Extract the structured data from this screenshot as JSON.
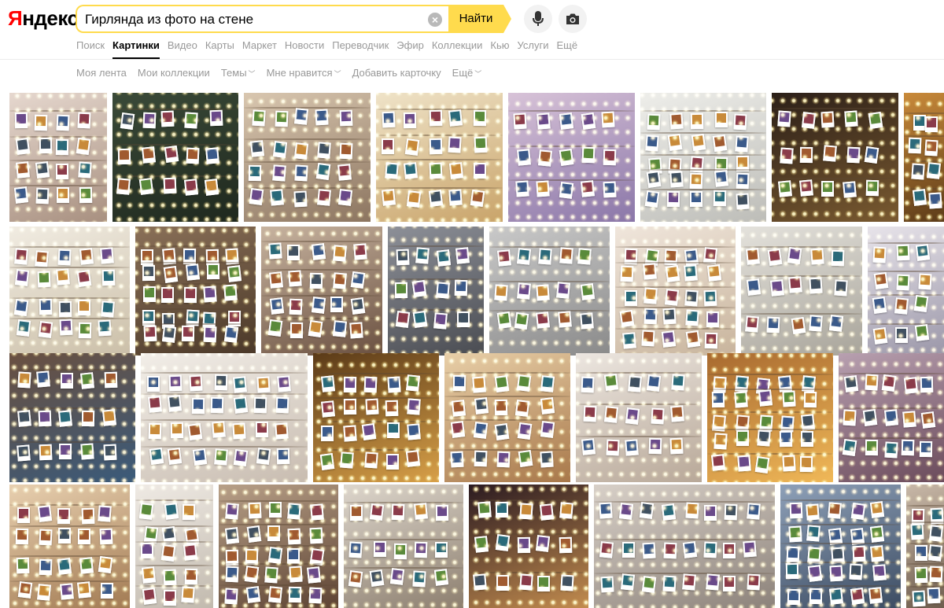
{
  "header": {
    "logo_first": "Я",
    "logo_rest": "ндекс",
    "search_value": "Гирлянда из фото на стене",
    "search_button": "Найти"
  },
  "tabs": [
    {
      "label": "Поиск",
      "active": false
    },
    {
      "label": "Картинки",
      "active": true
    },
    {
      "label": "Видео",
      "active": false
    },
    {
      "label": "Карты",
      "active": false
    },
    {
      "label": "Маркет",
      "active": false
    },
    {
      "label": "Новости",
      "active": false
    },
    {
      "label": "Переводчик",
      "active": false
    },
    {
      "label": "Эфир",
      "active": false
    },
    {
      "label": "Коллекции",
      "active": false
    },
    {
      "label": "Кью",
      "active": false
    },
    {
      "label": "Услуги",
      "active": false
    },
    {
      "label": "Ещё",
      "active": false
    }
  ],
  "subnav": [
    {
      "label": "Моя лента",
      "dropdown": false
    },
    {
      "label": "Мои коллекции",
      "dropdown": false
    },
    {
      "label": "Темы",
      "dropdown": true
    },
    {
      "label": "Мне нравится",
      "dropdown": true
    },
    {
      "label": "Добавить карточку",
      "dropdown": false
    },
    {
      "label": "Ещё",
      "dropdown": true
    }
  ],
  "image_rows": [
    [
      {
        "colors": [
          "#e6d8cf",
          "#a89080"
        ]
      },
      {
        "colors": [
          "#3a4a38",
          "#1f281e"
        ]
      },
      {
        "colors": [
          "#d9c7b0",
          "#8c7560"
        ]
      },
      {
        "colors": [
          "#efe3c8",
          "#c9a46a"
        ]
      },
      {
        "colors": [
          "#d8c3d8",
          "#8a76a8"
        ]
      },
      {
        "colors": [
          "#eeeeea",
          "#bdbdb8"
        ]
      },
      {
        "colors": [
          "#2b1f18",
          "#7a5a30"
        ]
      },
      {
        "colors": [
          "#c98a3a",
          "#5a3a18"
        ]
      }
    ],
    [
      {
        "colors": [
          "#f1ece2",
          "#cbbfa8"
        ]
      },
      {
        "colors": [
          "#8a7058",
          "#4a3828"
        ]
      },
      {
        "colors": [
          "#c8b4a0",
          "#6a5040"
        ]
      },
      {
        "colors": [
          "#8d9098",
          "#4a4c52"
        ]
      },
      {
        "colors": [
          "#c9c9c9",
          "#8a8a8a"
        ]
      },
      {
        "colors": [
          "#f0e6dc",
          "#c8b49c"
        ]
      },
      {
        "colors": [
          "#e4e2dc",
          "#a8a49a"
        ]
      },
      {
        "colors": [
          "#e8e4ea",
          "#9a96a8"
        ]
      }
    ],
    [
      {
        "colors": [
          "#6a5040",
          "#3a5a7a"
        ]
      },
      {
        "colors": [
          "#f2eee8",
          "#c8bcb0"
        ]
      },
      {
        "colors": [
          "#5a3a18",
          "#d8a048"
        ]
      },
      {
        "colors": [
          "#e8cfa8",
          "#a8784a"
        ]
      },
      {
        "colors": [
          "#ece6e0",
          "#b8a898"
        ]
      },
      {
        "colors": [
          "#a86a30",
          "#f0b858"
        ]
      },
      {
        "colors": [
          "#b8a0b0",
          "#6a4a5a"
        ]
      }
    ],
    [
      {
        "colors": [
          "#e8d0b0",
          "#a07850"
        ]
      },
      {
        "colors": [
          "#efeae4",
          "#c0b8ac"
        ]
      },
      {
        "colors": [
          "#b8a088",
          "#5a4030"
        ]
      },
      {
        "colors": [
          "#ddd6cc",
          "#8a7c6c"
        ]
      },
      {
        "colors": [
          "#2a1a20",
          "#c89050"
        ]
      },
      {
        "colors": [
          "#d8d0c8",
          "#8a8078"
        ]
      },
      {
        "colors": [
          "#8ea0b8",
          "#3a4a60"
        ]
      },
      {
        "colors": [
          "#c8b8a8",
          "#6a5848"
        ]
      }
    ]
  ]
}
